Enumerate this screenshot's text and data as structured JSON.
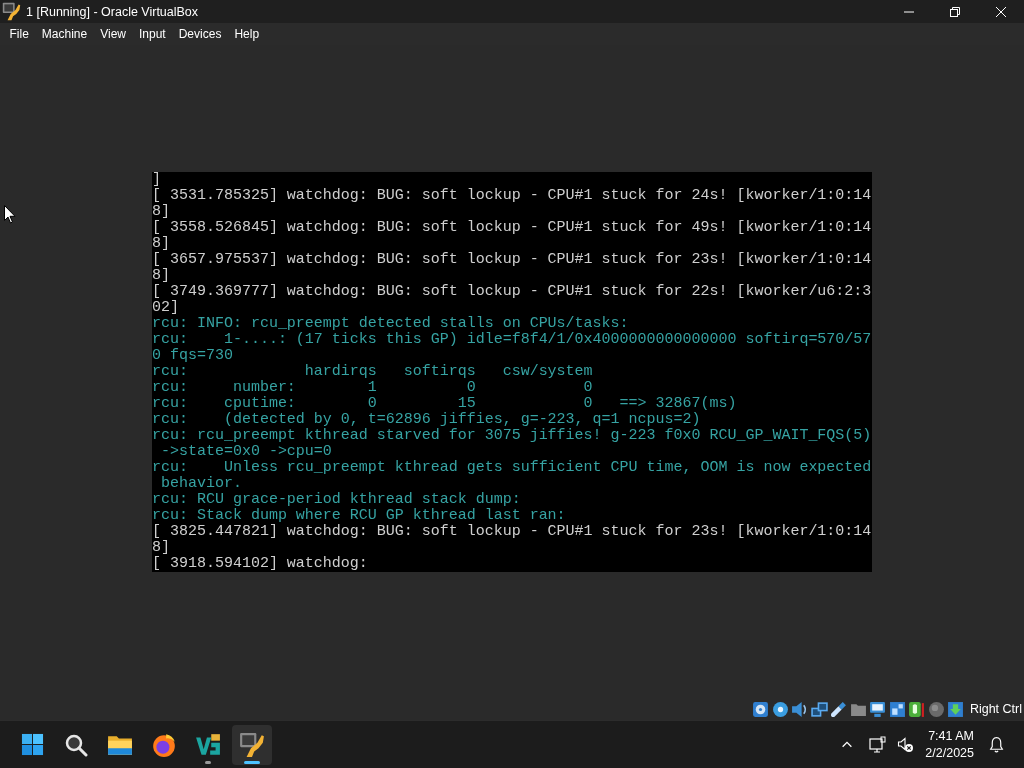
{
  "window": {
    "title": "1 [Running] - Oracle VirtualBox"
  },
  "menu": [
    "File",
    "Machine",
    "View",
    "Input",
    "Devices",
    "Help"
  ],
  "console": {
    "lines": [
      {
        "text": "]",
        "kind": "plain"
      },
      {
        "text": "[ 3531.785325] watchdog: BUG: soft lockup - CPU#1 stuck for 24s! [kworker/1:0:14",
        "kind": "plain"
      },
      {
        "text": "8]",
        "kind": "plain"
      },
      {
        "text": "[ 3558.526845] watchdog: BUG: soft lockup - CPU#1 stuck for 49s! [kworker/1:0:14",
        "kind": "plain"
      },
      {
        "text": "8]",
        "kind": "plain"
      },
      {
        "text": "[ 3657.975537] watchdog: BUG: soft lockup - CPU#1 stuck for 23s! [kworker/1:0:14",
        "kind": "plain"
      },
      {
        "text": "8]",
        "kind": "plain"
      },
      {
        "text": "[ 3749.369777] watchdog: BUG: soft lockup - CPU#1 stuck for 22s! [kworker/u6:2:3",
        "kind": "plain"
      },
      {
        "text": "02]",
        "kind": "plain"
      },
      {
        "text": "rcu: INFO: rcu_preempt detected stalls on CPUs/tasks:",
        "kind": "rcu"
      },
      {
        "text": "rcu:    1-....: (17 ticks this GP) idle=f8f4/1/0x4000000000000000 softirq=570/57",
        "kind": "rcu"
      },
      {
        "text": "0 fqs=730",
        "kind": "rcu"
      },
      {
        "text": "rcu:             hardirqs   softirqs   csw/system",
        "kind": "rcu"
      },
      {
        "text": "rcu:     number:        1          0            0",
        "kind": "rcu"
      },
      {
        "text": "rcu:    cputime:        0         15            0   ==> 32867(ms)",
        "kind": "rcu"
      },
      {
        "text": "rcu:    (detected by 0, t=62896 jiffies, g=-223, q=1 ncpus=2)",
        "kind": "rcu"
      },
      {
        "text": "rcu: rcu_preempt kthread starved for 3075 jiffies! g-223 f0x0 RCU_GP_WAIT_FQS(5)",
        "kind": "rcu"
      },
      {
        "text": " ->state=0x0 ->cpu=0",
        "kind": "rcu"
      },
      {
        "text": "rcu:    Unless rcu_preempt kthread gets sufficient CPU time, OOM is now expected",
        "kind": "rcu"
      },
      {
        "text": " behavior.",
        "kind": "rcu"
      },
      {
        "text": "rcu: RCU grace-period kthread stack dump:",
        "kind": "rcu"
      },
      {
        "text": "rcu: Stack dump where RCU GP kthread last ran:",
        "kind": "rcu"
      },
      {
        "text": "[ 3825.447821] watchdog: BUG: soft lockup - CPU#1 stuck for 23s! [kworker/1:0:14",
        "kind": "plain"
      },
      {
        "text": "8]",
        "kind": "plain"
      },
      {
        "text": "[ 3918.594102] watchdog:",
        "kind": "plain"
      }
    ]
  },
  "status_bar": {
    "host_key": "Right Ctrl"
  },
  "taskbar": {
    "apps": [
      {
        "open": false,
        "selected": false
      },
      {
        "open": false,
        "selected": false
      },
      {
        "open": true,
        "selected": false
      },
      {
        "open": true,
        "selected": true
      }
    ],
    "clock": {
      "time": "7:41 AM",
      "date": "2/2/2025"
    }
  }
}
